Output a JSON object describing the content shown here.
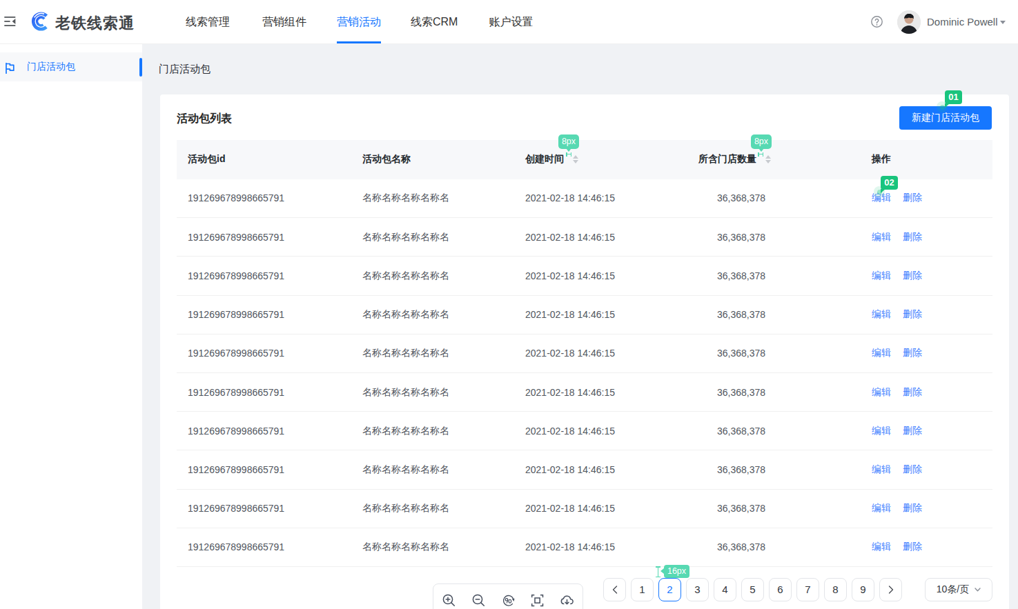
{
  "header": {
    "logo_text": "老铁线索通",
    "icons": {
      "collapse": "menu-fold-icon",
      "logo": "logo-icon",
      "help": "help-icon",
      "user_caret": "caret-down-icon"
    },
    "nav": [
      {
        "label": "线索管理",
        "active": false
      },
      {
        "label": "营销组件",
        "active": false
      },
      {
        "label": "营销活动",
        "active": true
      },
      {
        "label": "线索CRM",
        "active": false
      },
      {
        "label": "账户设置",
        "active": false
      }
    ],
    "user_name": "Dominic Powell"
  },
  "sidebar": {
    "items": [
      {
        "label": "门店活动包",
        "icon": "flag-icon",
        "active": true
      }
    ]
  },
  "page": {
    "title": "门店活动包",
    "card_title": "活动包列表",
    "create_button_label": "新建门店活动包"
  },
  "table": {
    "columns": [
      {
        "label": "活动包id",
        "sortable": false
      },
      {
        "label": "活动包名称",
        "sortable": false
      },
      {
        "label": "创建时间",
        "sortable": true,
        "sort_icon": "sorter-carets-icon"
      },
      {
        "label": "所含门店数量",
        "sortable": true,
        "sort_icon": "sorter-carets-icon"
      },
      {
        "label": "操作",
        "sortable": false
      }
    ],
    "edit_label": "编辑",
    "delete_label": "删除",
    "rows": [
      {
        "id": "191269678998665791",
        "name": "名称名称名称名称名",
        "created": "2021-02-18 14:46:15",
        "count": "36,368,378"
      },
      {
        "id": "191269678998665791",
        "name": "名称名称名称名称名",
        "created": "2021-02-18 14:46:15",
        "count": "36,368,378"
      },
      {
        "id": "191269678998665791",
        "name": "名称名称名称名称名",
        "created": "2021-02-18 14:46:15",
        "count": "36,368,378"
      },
      {
        "id": "191269678998665791",
        "name": "名称名称名称名称名",
        "created": "2021-02-18 14:46:15",
        "count": "36,368,378"
      },
      {
        "id": "191269678998665791",
        "name": "名称名称名称名称名",
        "created": "2021-02-18 14:46:15",
        "count": "36,368,378"
      },
      {
        "id": "191269678998665791",
        "name": "名称名称名称名称名",
        "created": "2021-02-18 14:46:15",
        "count": "36,368,378"
      },
      {
        "id": "191269678998665791",
        "name": "名称名称名称名称名",
        "created": "2021-02-18 14:46:15",
        "count": "36,368,378"
      },
      {
        "id": "191269678998665791",
        "name": "名称名称名称名称名",
        "created": "2021-02-18 14:46:15",
        "count": "36,368,378"
      },
      {
        "id": "191269678998665791",
        "name": "名称名称名称名称名",
        "created": "2021-02-18 14:46:15",
        "count": "36,368,378"
      },
      {
        "id": "191269678998665791",
        "name": "名称名称名称名称名",
        "created": "2021-02-18 14:46:15",
        "count": "36,368,378"
      }
    ]
  },
  "pagination": {
    "prev_icon": "chevron-left-icon",
    "pages": [
      {
        "num": "1"
      },
      {
        "num": "2",
        "active": true
      },
      {
        "num": "3"
      },
      {
        "num": "4"
      },
      {
        "num": "5"
      },
      {
        "num": "6"
      },
      {
        "num": "7"
      },
      {
        "num": "8"
      },
      {
        "num": "9"
      }
    ],
    "active_page": "2",
    "next_icon": "chevron-right-icon",
    "page_size": "10条/页",
    "size_select_icon": "chevron-down-icon"
  },
  "viewer_toolbar": {
    "icons": [
      "zoom-in-icon",
      "zoom-out-icon",
      "rotate-90-icon",
      "fit-screen-icon",
      "cloud-download-icon"
    ]
  },
  "annotations": {
    "marker_01": "01",
    "marker_02": "02",
    "gap_8px_a": "8px",
    "gap_8px_b": "8px",
    "gap_16px": "16px",
    "marker_color": "#19c47d",
    "measure_color": "#57d9b2"
  },
  "colors": {
    "primary": "#1677ff",
    "link": "#3d7eff",
    "content_bg": "#f0f2f5",
    "table_header_bg": "#f7f8fa"
  }
}
